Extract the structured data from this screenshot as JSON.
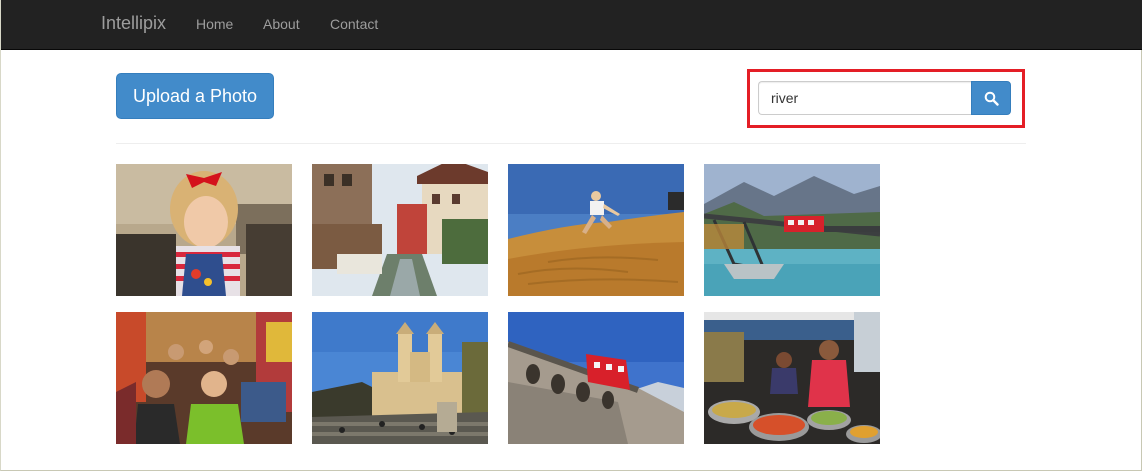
{
  "navbar": {
    "brand": "Intellipix",
    "links": [
      {
        "label": "Home"
      },
      {
        "label": "About"
      },
      {
        "label": "Contact"
      }
    ]
  },
  "toolbar": {
    "upload_label": "Upload a Photo"
  },
  "search": {
    "value": "river",
    "button_icon": "search-icon",
    "highlight_color": "#e41e26"
  },
  "colors": {
    "navbar_bg": "#222222",
    "navbar_text": "#9d9d9d",
    "primary": "#428bca"
  },
  "photos": [
    {
      "subject": "girl-with-red-bow"
    },
    {
      "subject": "canal-town"
    },
    {
      "subject": "desert-dunes"
    },
    {
      "subject": "red-train-bridge"
    },
    {
      "subject": "market-crowd"
    },
    {
      "subject": "church-steps"
    },
    {
      "subject": "red-train-viaduct"
    },
    {
      "subject": "food-vendor"
    }
  ]
}
